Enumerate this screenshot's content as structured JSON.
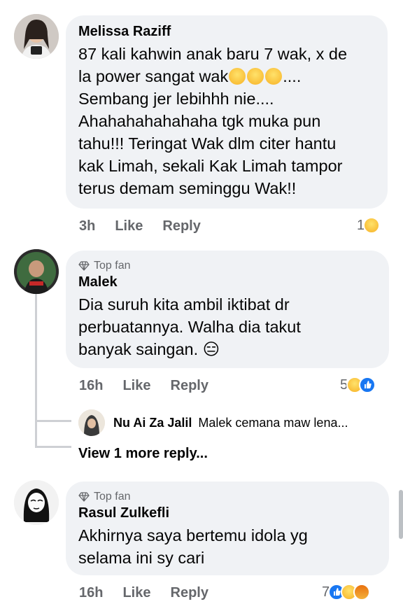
{
  "comments": [
    {
      "author": "Melissa Raziff",
      "top_fan": false,
      "lines": [
        "87 kali kahwin anak baru 7 wak, x de",
        "la power sangat wak",
        "....",
        "Sembang jer lebihhh nie....",
        "Ahahahahahahaha tgk muka pun",
        "tahu!!! Teringat Wak dlm citer hantu",
        "kak Limah, sekali Kak Limah tampor",
        "terus demam seminggu Wak!!"
      ],
      "time": "3h",
      "like": "Like",
      "reply": "Reply",
      "reaction_count": "1",
      "reactions": [
        "haha"
      ]
    },
    {
      "author": "Malek",
      "top_fan": true,
      "badge": "Top fan",
      "lines": [
        "Dia suruh kita ambil iktibat dr",
        "perbuatannya. Walha dia takut",
        "banyak saingan. 😑"
      ],
      "time": "16h",
      "like": "Like",
      "reply": "Reply",
      "reaction_count": "5",
      "reactions": [
        "haha",
        "like"
      ]
    },
    {
      "author": "Rasul Zulkefli",
      "top_fan": true,
      "badge": "Top fan",
      "lines": [
        "Akhirnya saya bertemu idola yg",
        "selama ini sy cari"
      ],
      "time": "16h",
      "like": "Like",
      "reply": "Reply",
      "reaction_count": "7",
      "reactions": [
        "like",
        "haha",
        "angry"
      ]
    }
  ],
  "reply_preview": {
    "author": "Nu Ai Za Jalil",
    "text": "Malek cemana maw lena..."
  },
  "view_more": "View 1 more reply...",
  "colors": {
    "bubble": "#f0f2f5",
    "meta": "#65676b",
    "like_blue": "#1877f2",
    "haha_yellow": "#f7b125"
  }
}
